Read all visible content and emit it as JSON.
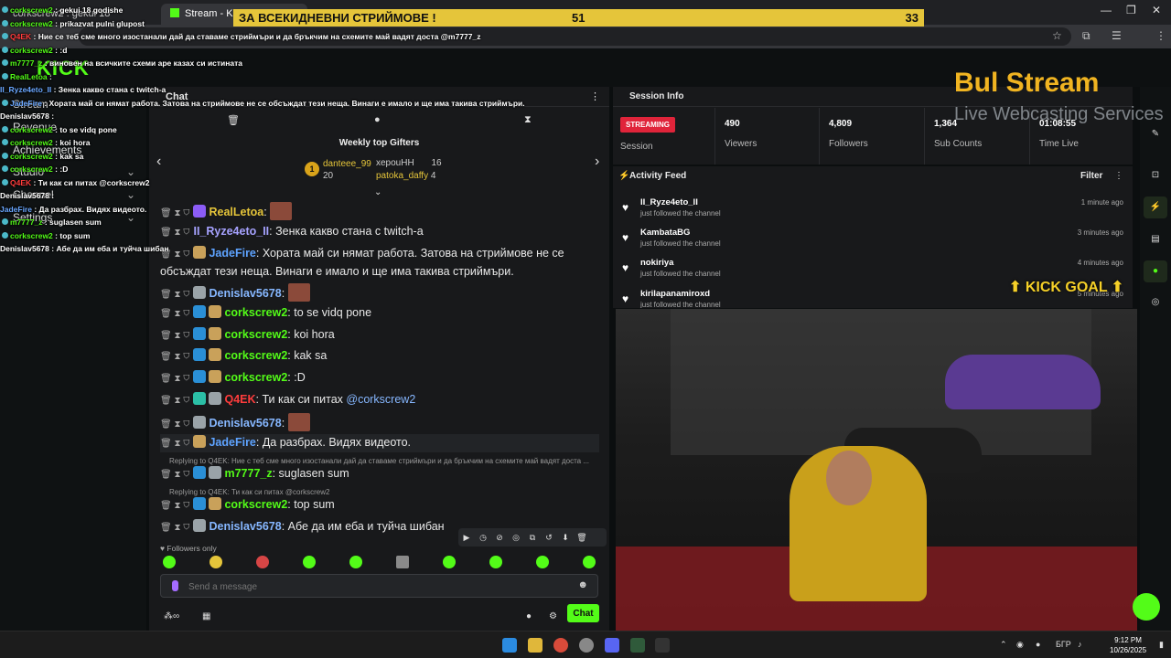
{
  "browser": {
    "tabs": [
      {
        "label": "corkscrew2 : gekui 18 godisheBUBOV"
      },
      {
        "label": "Stream - Kick Dash"
      }
    ],
    "window_controls": [
      "—",
      "❐",
      "✕"
    ]
  },
  "banner": {
    "text": "ЗА ВСЕКИДНЕВНИ СТРИЙМОВЕ !",
    "left_count": "51",
    "right_count": "33"
  },
  "overlay_chat": [
    {
      "user": "corkscrew2",
      "color": "green",
      "text": "gekui 18 godishe"
    },
    {
      "user": "corkscrew2",
      "color": "green",
      "text": "prikazvat pulni glupost"
    },
    {
      "user": "Q4EK",
      "color": "red",
      "text": "Ние се теб сме много изостанали дай да ставаме стриймъри и да бръкчим на схемите май вадят доста @m7777_z"
    },
    {
      "user": "corkscrew2",
      "color": "green",
      "text": ":d"
    },
    {
      "user": "m7777_z",
      "color": "green",
      "text": "виновен на всичките схеми аре казах си истината"
    },
    {
      "user": "RealLetoa",
      "color": "green",
      "text": ""
    },
    {
      "user": "II_Ryze4eto_II",
      "color": "blue",
      "text": "Зенка какво стана с twitch-a"
    },
    {
      "user": "JadeFire",
      "color": "blue",
      "text": "Хората май си нямат работа. Затова на стриймове не се обсъждат тези неща. Винаги е имало и ще има такива стриймъри."
    },
    {
      "user": "Denislav5678",
      "color": "white",
      "text": ""
    },
    {
      "user": "corkscrew2",
      "color": "green",
      "text": "to se vidq pone"
    },
    {
      "user": "corkscrew2",
      "color": "green",
      "text": "koi hora"
    },
    {
      "user": "corkscrew2",
      "color": "green",
      "text": "kak sa"
    },
    {
      "user": "corkscrew2",
      "color": "green",
      "text": ":D"
    },
    {
      "user": "Q4EK",
      "color": "red",
      "text": "Ти как си питах @corkscrew2"
    },
    {
      "user": "Denislav5678",
      "color": "white",
      "text": ""
    },
    {
      "user": "JadeFire",
      "color": "blue",
      "text": "Да разбрах. Видях видеото."
    },
    {
      "user": "m7777_z",
      "color": "green",
      "text": "suglasen sum"
    },
    {
      "user": "corkscrew2",
      "color": "green",
      "text": "top sum"
    },
    {
      "user": "Denislav5678",
      "color": "white",
      "text": "Абе да им еба и туйча шибан"
    }
  ],
  "sidebar": {
    "logo": "KICK",
    "items": [
      {
        "label": "Stream"
      },
      {
        "label": "Revenue"
      },
      {
        "label": "Achievements"
      },
      {
        "label": "Studio"
      },
      {
        "label": "Channel"
      },
      {
        "label": "Settings"
      }
    ]
  },
  "chat": {
    "title": "Chat",
    "gifters_title": "Weekly top Gifters",
    "gifters": [
      {
        "rank": "1",
        "name": "danteee_99",
        "count": "20"
      },
      {
        "rank": "2",
        "name": "xepouHH",
        "count": "16"
      },
      {
        "rank": "3",
        "name": "patoka_daffy",
        "count": "4"
      }
    ],
    "messages": [
      {
        "user": "RealLetoa",
        "text": ""
      },
      {
        "user": "II_Ryze4eto_II",
        "text": "Зенка какво стана с twitch-a"
      },
      {
        "user": "JadeFire",
        "text": "Хората май си нямат работа. Затова на стриймове не се обсъждат тези неща. Винаги е имало и ще има такива стриймъри."
      },
      {
        "user": "Denislav5678",
        "text": ""
      },
      {
        "user": "corkscrew2",
        "text": "to se vidq pone"
      },
      {
        "user": "corkscrew2",
        "text": "koi hora"
      },
      {
        "user": "corkscrew2",
        "text": "kak sa"
      },
      {
        "user": "corkscrew2",
        "text": ":D"
      },
      {
        "user": "Q4EK",
        "text": "Ти как си питах",
        "mention": "@corkscrew2"
      },
      {
        "user": "Denislav5678",
        "text": ""
      },
      {
        "user": "JadeFire",
        "text": "Да разбрах. Видях видеото."
      },
      {
        "user": "m7777_z",
        "text": "suglasen sum",
        "reply_to": "Replying to Q4EK: Ние с теб сме много изостанали дай да ставаме стриймъри и да бръкчим на схемите май вадят доста ..."
      },
      {
        "user": "corkscrew2",
        "text": "top sum",
        "reply_to": "Replying to Q4EK: Ти как си питах @corkscrew2"
      },
      {
        "user": "Denislav5678",
        "text": "Абе да им еба и туйча шибан"
      }
    ],
    "followers_only": "Followers only",
    "input_placeholder": "Send a message",
    "chat_button": "Chat"
  },
  "session": {
    "title": "Session Info",
    "status": "STREAMING",
    "status_label": "Session",
    "stats": [
      {
        "value": "490",
        "label": "Viewers"
      },
      {
        "value": "4,809",
        "label": "Followers"
      },
      {
        "value": "1,364",
        "label": "Sub Counts"
      },
      {
        "value": "01:08:55",
        "label": "Time Live"
      }
    ]
  },
  "activity": {
    "title": "Activity Feed",
    "filter": "Filter",
    "items": [
      {
        "name": "II_Ryze4eto_II",
        "desc": "just followed the channel",
        "time": "1 minute ago"
      },
      {
        "name": "KambataBG",
        "desc": "just followed the channel",
        "time": "3 minutes ago"
      },
      {
        "name": "nokiriya",
        "desc": "just followed the channel",
        "time": "4 minutes ago"
      },
      {
        "name": "kirilapanamiroxd",
        "desc": "just followed the channel",
        "time": "5 minutes ago"
      }
    ]
  },
  "overlays": {
    "logo_main": "Bul Stream",
    "logo_sub": "Live Webcasting Services",
    "kick_goal": "⬆ KICK GOAL ⬆"
  },
  "taskbar": {
    "lang": "БГР",
    "time": "9:12 PM",
    "date": "10/26/2025"
  },
  "colors": {
    "kick_green": "#53fc18",
    "streaming_red": "#e0243a",
    "banner_yellow": "#e5c53a"
  }
}
